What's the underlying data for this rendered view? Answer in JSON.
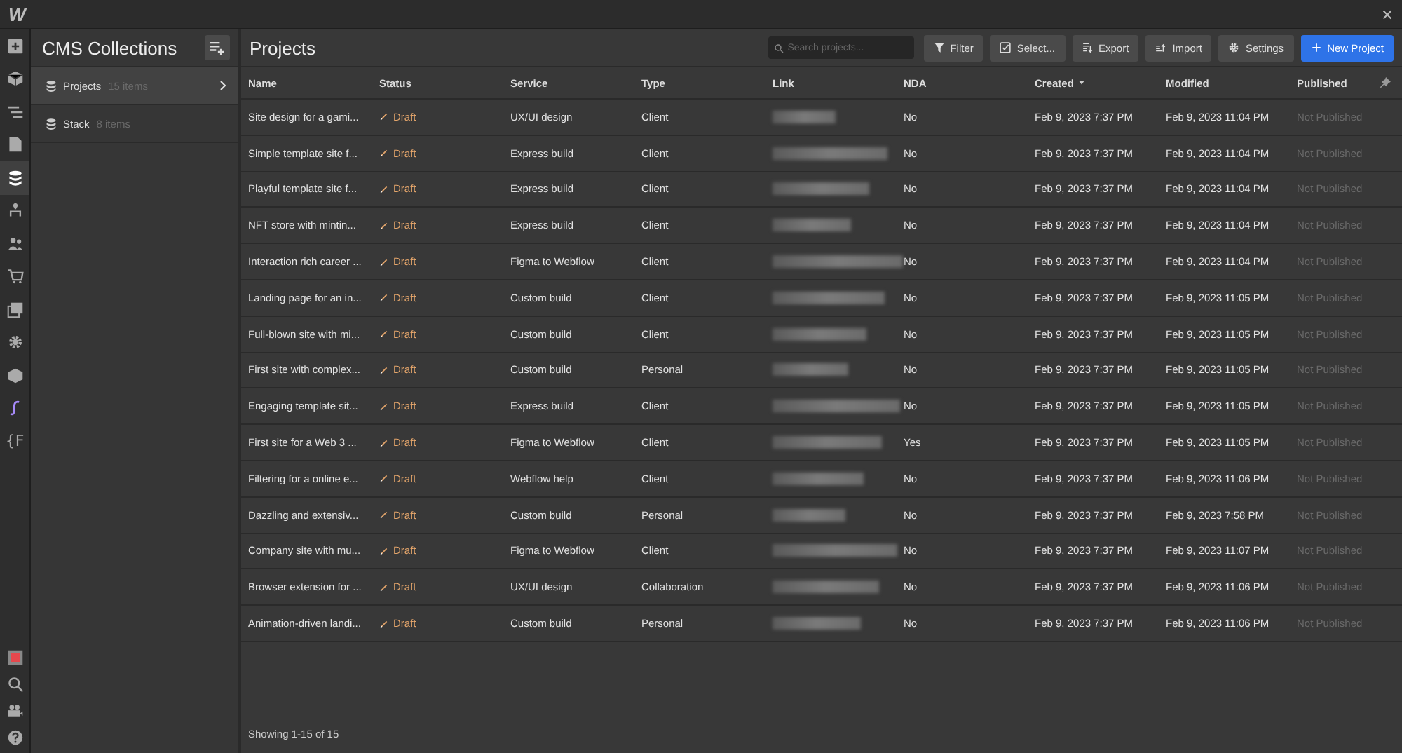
{
  "app": {
    "logo": "W"
  },
  "rail": [
    {
      "kind": "add",
      "selected": false
    },
    {
      "kind": "box",
      "selected": false
    },
    {
      "kind": "navigator",
      "selected": false
    },
    {
      "kind": "page",
      "selected": false
    },
    {
      "kind": "cms",
      "selected": true
    },
    {
      "kind": "logic",
      "selected": false
    },
    {
      "kind": "users",
      "selected": false
    },
    {
      "kind": "cart",
      "selected": false
    },
    {
      "kind": "assets",
      "selected": false
    },
    {
      "kind": "settings",
      "selected": false
    },
    {
      "kind": "cube",
      "selected": false
    },
    {
      "kind": "script",
      "selected": false
    },
    {
      "kind": "text",
      "text": "{F",
      "selected": false
    }
  ],
  "rail_bottom": [
    {
      "kind": "record"
    },
    {
      "kind": "search"
    },
    {
      "kind": "video"
    },
    {
      "kind": "help"
    }
  ],
  "collections": {
    "title": "CMS Collections",
    "items": [
      {
        "name": "Projects",
        "count": "15 items",
        "selected": true
      },
      {
        "name": "Stack",
        "count": "8 items",
        "selected": false
      }
    ]
  },
  "main": {
    "title": "Projects",
    "search": {
      "placeholder": "Search projects..."
    },
    "buttons": [
      {
        "kind": "filter",
        "label": "Filter",
        "primary": false
      },
      {
        "kind": "select",
        "label": "Select...",
        "primary": false
      },
      {
        "kind": "export",
        "label": "Export",
        "primary": false
      },
      {
        "kind": "import",
        "label": "Import",
        "primary": false
      },
      {
        "kind": "settings",
        "label": "Settings",
        "primary": false
      },
      {
        "kind": "add",
        "label": "New Project",
        "primary": true
      }
    ]
  },
  "table": {
    "columns": [
      {
        "label": "Name",
        "sorted": false
      },
      {
        "label": "Status",
        "sorted": false
      },
      {
        "label": "Service",
        "sorted": false
      },
      {
        "label": "Type",
        "sorted": false
      },
      {
        "label": "Link",
        "sorted": false
      },
      {
        "label": "NDA",
        "sorted": false
      },
      {
        "label": "Created",
        "sorted": true
      },
      {
        "label": "Modified",
        "sorted": false
      },
      {
        "label": "Published",
        "sorted": false
      }
    ],
    "rows": [
      {
        "name": "Site design for a gami...",
        "status": "Draft",
        "service": "UX/UI design",
        "type": "Client",
        "nda": "No",
        "created": "Feb 9, 2023 7:37 PM",
        "modified": "Feb 9, 2023 11:04 PM",
        "published": "Not Published"
      },
      {
        "name": "Simple template site f...",
        "status": "Draft",
        "service": "Express build",
        "type": "Client",
        "nda": "No",
        "created": "Feb 9, 2023 7:37 PM",
        "modified": "Feb 9, 2023 11:04 PM",
        "published": "Not Published"
      },
      {
        "name": "Playful template site f...",
        "status": "Draft",
        "service": "Express build",
        "type": "Client",
        "nda": "No",
        "created": "Feb 9, 2023 7:37 PM",
        "modified": "Feb 9, 2023 11:04 PM",
        "published": "Not Published"
      },
      {
        "name": "NFT store with mintin...",
        "status": "Draft",
        "service": "Express build",
        "type": "Client",
        "nda": "No",
        "created": "Feb 9, 2023 7:37 PM",
        "modified": "Feb 9, 2023 11:04 PM",
        "published": "Not Published"
      },
      {
        "name": "Interaction rich career ...",
        "status": "Draft",
        "service": "Figma to Webflow",
        "type": "Client",
        "nda": "No",
        "created": "Feb 9, 2023 7:37 PM",
        "modified": "Feb 9, 2023 11:04 PM",
        "published": "Not Published"
      },
      {
        "name": "Landing page for an in...",
        "status": "Draft",
        "service": "Custom build",
        "type": "Client",
        "nda": "No",
        "created": "Feb 9, 2023 7:37 PM",
        "modified": "Feb 9, 2023 11:05 PM",
        "published": "Not Published"
      },
      {
        "name": "Full-blown site with mi...",
        "status": "Draft",
        "service": "Custom build",
        "type": "Client",
        "nda": "No",
        "created": "Feb 9, 2023 7:37 PM",
        "modified": "Feb 9, 2023 11:05 PM",
        "published": "Not Published"
      },
      {
        "name": "First site with complex...",
        "status": "Draft",
        "service": "Custom build",
        "type": "Personal",
        "nda": "No",
        "created": "Feb 9, 2023 7:37 PM",
        "modified": "Feb 9, 2023 11:05 PM",
        "published": "Not Published"
      },
      {
        "name": "Engaging template sit...",
        "status": "Draft",
        "service": "Express build",
        "type": "Client",
        "nda": "No",
        "created": "Feb 9, 2023 7:37 PM",
        "modified": "Feb 9, 2023 11:05 PM",
        "published": "Not Published"
      },
      {
        "name": "First site for a Web 3 ...",
        "status": "Draft",
        "service": "Figma to Webflow",
        "type": "Client",
        "nda": "Yes",
        "created": "Feb 9, 2023 7:37 PM",
        "modified": "Feb 9, 2023 11:05 PM",
        "published": "Not Published"
      },
      {
        "name": "Filtering for a online e...",
        "status": "Draft",
        "service": "Webflow help",
        "type": "Client",
        "nda": "No",
        "created": "Feb 9, 2023 7:37 PM",
        "modified": "Feb 9, 2023 11:06 PM",
        "published": "Not Published"
      },
      {
        "name": "Dazzling and extensiv...",
        "status": "Draft",
        "service": "Custom build",
        "type": "Personal",
        "nda": "No",
        "created": "Feb 9, 2023 7:37 PM",
        "modified": "Feb 9, 2023 7:58 PM",
        "published": "Not Published"
      },
      {
        "name": "Company site with mu...",
        "status": "Draft",
        "service": "Figma to Webflow",
        "type": "Client",
        "nda": "No",
        "created": "Feb 9, 2023 7:37 PM",
        "modified": "Feb 9, 2023 11:07 PM",
        "published": "Not Published"
      },
      {
        "name": "Browser extension for ...",
        "status": "Draft",
        "service": "UX/UI design",
        "type": "Collaboration",
        "nda": "No",
        "created": "Feb 9, 2023 7:37 PM",
        "modified": "Feb 9, 2023 11:06 PM",
        "published": "Not Published"
      },
      {
        "name": "Animation-driven landi...",
        "status": "Draft",
        "service": "Custom build",
        "type": "Personal",
        "nda": "No",
        "created": "Feb 9, 2023 7:37 PM",
        "modified": "Feb 9, 2023 11:06 PM",
        "published": "Not Published"
      }
    ]
  },
  "footer": "Showing 1-15 of 15"
}
